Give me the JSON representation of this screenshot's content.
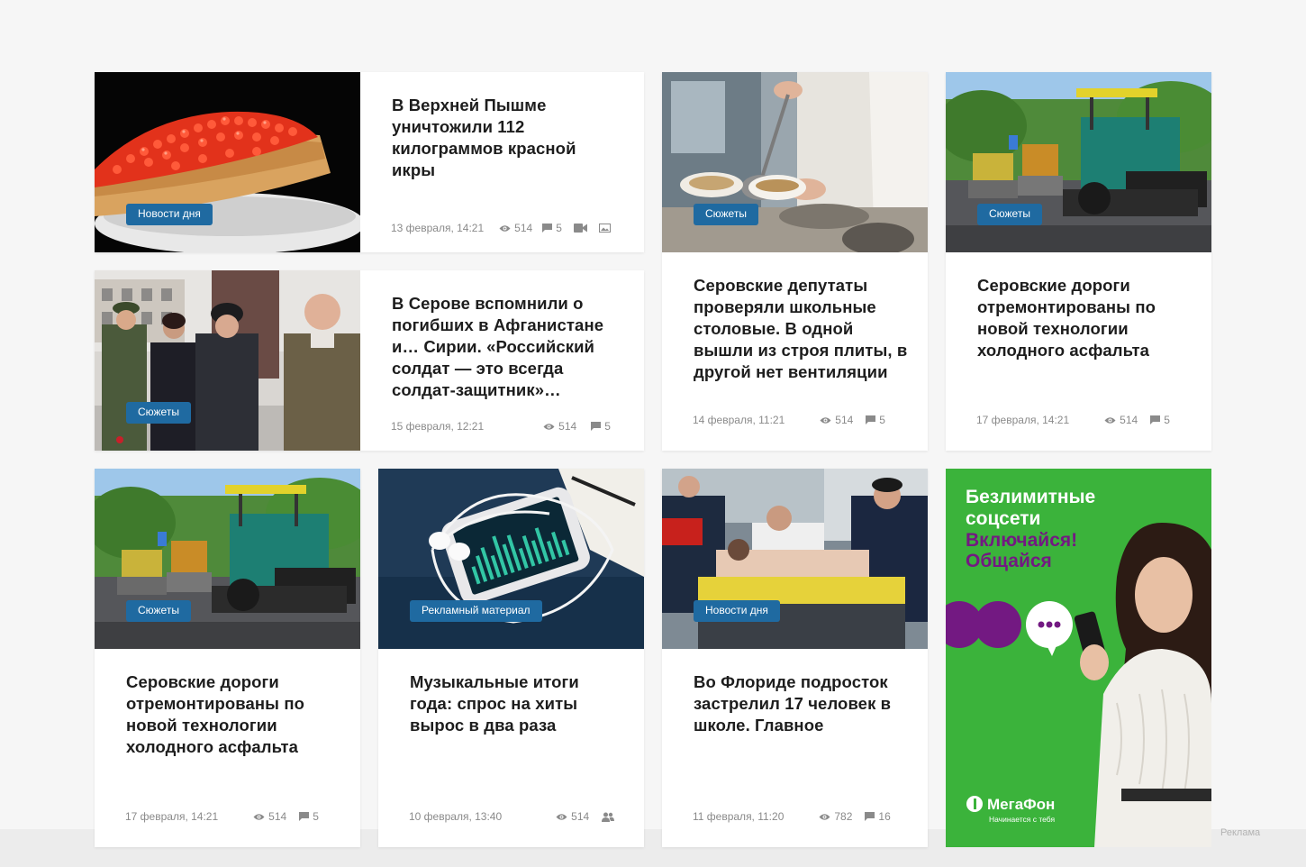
{
  "cards": [
    {
      "id": "caviar",
      "tag": "Новости дня",
      "title": "В Верхней Пышме уничтожили 112 килограммов красной икры",
      "date": "13 февраля, 14:21",
      "views": "514",
      "comments": "5"
    },
    {
      "id": "afghan",
      "tag": "Сюжеты",
      "title": "В Серове вспомнили о погибших в Афганистане и… Сирии. «Российский солдат — это всегда солдат-защитник»…",
      "date": "15 февраля, 12:21",
      "views": "514",
      "comments": "5"
    },
    {
      "id": "canteen",
      "tag": "Сюжеты",
      "title": "Серовские депутаты проверяли школьные столовые. В одной вышли из строя плиты, в другой нет вентиляции",
      "date": "14 февраля, 11:21",
      "views": "514",
      "comments": "5"
    },
    {
      "id": "roads1",
      "tag": "Сюжеты",
      "title": "Серовские дороги отремонтированы по новой технологии холодного асфальта",
      "date": "17 февраля, 14:21",
      "views": "514",
      "comments": "5"
    },
    {
      "id": "roads2",
      "tag": "Сюжеты",
      "title": "Серовские дороги отремонтированы по новой технологии холодного асфальта",
      "date": "17 февраля, 14:21",
      "views": "514",
      "comments": "5"
    },
    {
      "id": "music",
      "tag": "Рекламный материал",
      "title": "Музыкальные итоги года: спрос на хиты вырос в два раза",
      "date": "10 февраля, 13:40",
      "views": "514"
    },
    {
      "id": "florida",
      "tag": "Новости дня",
      "title": "Во Флориде подросток застрелил 17 человек в школе. Главное",
      "date": "11 февраля, 11:20",
      "views": "782",
      "comments": "16"
    }
  ],
  "ad": {
    "line1": "Безлимитные",
    "line2": "соцсети",
    "line3": "Включайся!",
    "line4": "Общайся",
    "brand": "МегаФон",
    "slogan": "Начинается с тебя",
    "label": "Реклама",
    "colors": {
      "green": "#3bb33b",
      "purple": "#731982"
    }
  },
  "colors": {
    "tag": "#1f6aa1",
    "background": "#f6f6f6"
  }
}
